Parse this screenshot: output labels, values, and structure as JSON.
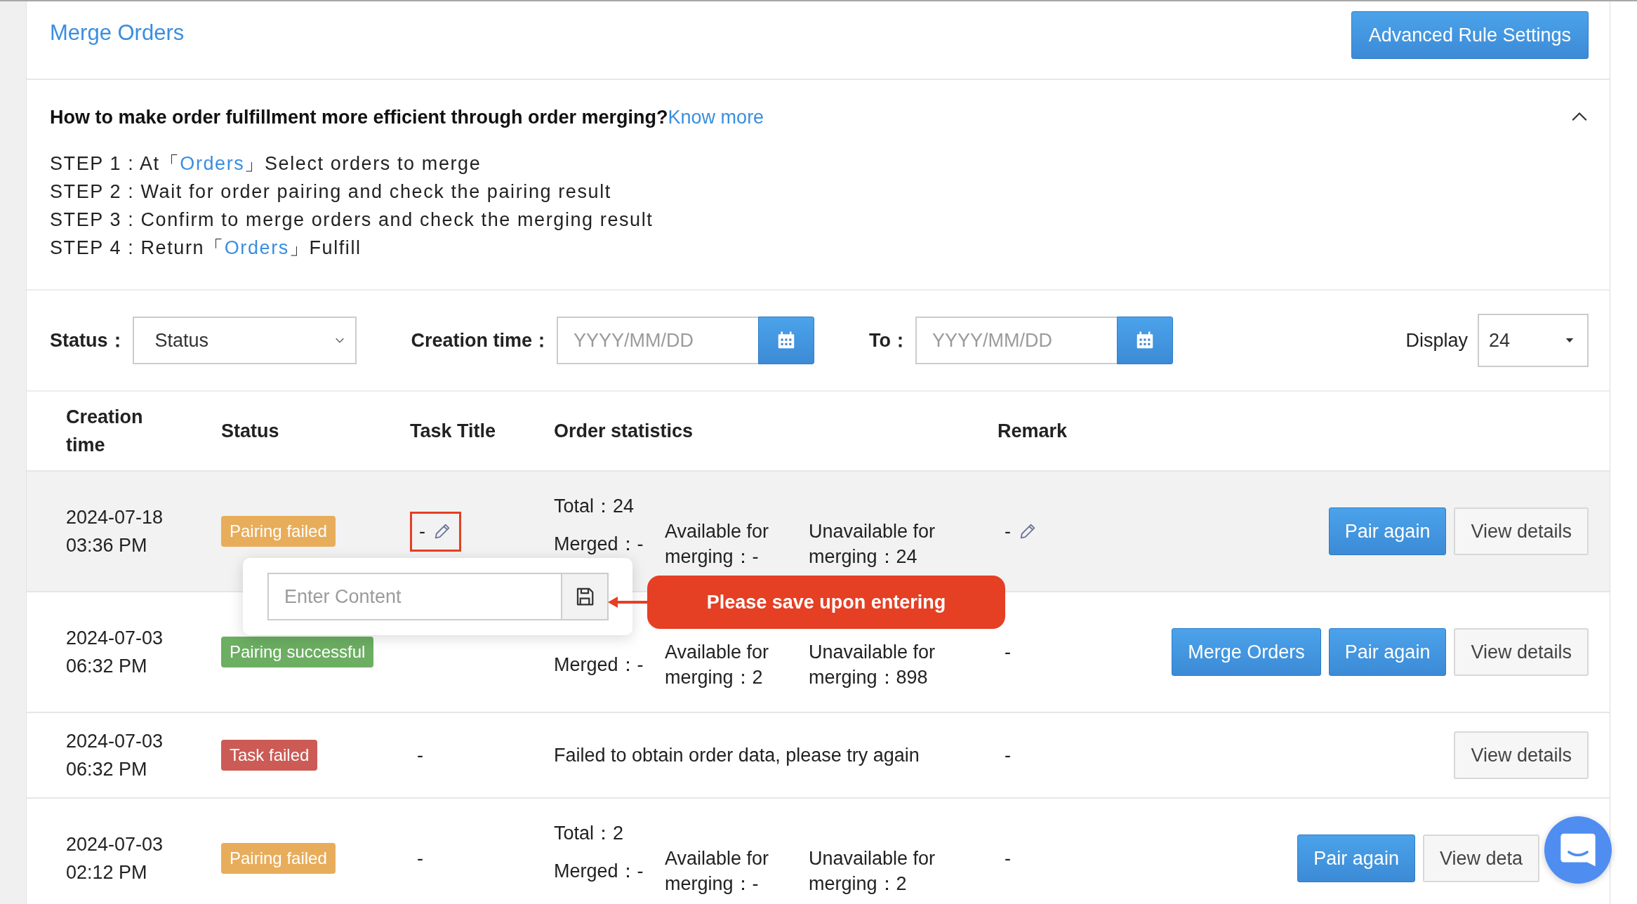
{
  "header": {
    "title": "Merge Orders",
    "button": "Advanced Rule Settings"
  },
  "guide": {
    "question": "How to make order fulfillment more efficient through order merging?",
    "link": "Know more",
    "expanded": true,
    "steps": [
      [
        {
          "text": "STEP 1 : At「"
        },
        {
          "text": "Orders",
          "link": true
        },
        {
          "text": "」Select orders to merge"
        }
      ],
      [
        {
          "text": "STEP 2 : Wait for order pairing and check the pairing result"
        }
      ],
      [
        {
          "text": "STEP 3 : Confirm to merge orders and check the merging result"
        }
      ],
      [
        {
          "text": "STEP 4 : Return「"
        },
        {
          "text": "Orders",
          "link": true
        },
        {
          "text": "」Fulfill"
        }
      ]
    ]
  },
  "filters": {
    "status_label": "Status：",
    "status_value": "Status",
    "creation_label": "Creation time：",
    "from_placeholder": "YYYY/MM/DD",
    "to_label": "To：",
    "to_placeholder": "YYYY/MM/DD",
    "display_label": "Display",
    "display_value": "24"
  },
  "table": {
    "columns": [
      "Creation time",
      "Status",
      "Task Title",
      "Order statistics",
      "Remark"
    ],
    "rows": [
      {
        "creation_time": "2024-07-18 03:36 PM",
        "status": {
          "label": "Pairing failed",
          "kind": "warning"
        },
        "task_title": "-",
        "task_editable": true,
        "highlighted": true,
        "hovered": true,
        "stats": {
          "kind": "counts",
          "total": "Total：24",
          "merged": "Merged：-",
          "available": "Available for merging：-",
          "unavailable": "Unavailable for merging：24"
        },
        "remark": "-",
        "remark_editable": true,
        "actions": [
          {
            "label": "Pair again",
            "kind": "primary"
          },
          {
            "label": "View details",
            "kind": "default"
          }
        ]
      },
      {
        "creation_time": "2024-07-03 06:32 PM",
        "status": {
          "label": "Pairing successful",
          "kind": "success"
        },
        "task_editable": false,
        "highlighted": false,
        "hovered": false,
        "stats": {
          "kind": "counts",
          "merged": "Merged：-",
          "available": "Available for merging：2",
          "unavailable": "Unavailable for merging：898"
        },
        "remark": "-",
        "remark_editable": false,
        "actions": [
          {
            "label": "Merge Orders",
            "kind": "primary"
          },
          {
            "label": "Pair again",
            "kind": "primary"
          },
          {
            "label": "View details",
            "kind": "default"
          }
        ]
      },
      {
        "creation_time": "2024-07-03 06:32 PM",
        "status": {
          "label": "Task failed",
          "kind": "danger"
        },
        "task_title": "-",
        "task_editable": false,
        "highlighted": false,
        "hovered": false,
        "stats": {
          "kind": "message",
          "text": "Failed to obtain order data, please try again"
        },
        "remark": "-",
        "remark_editable": false,
        "actions": [
          {
            "label": "View details",
            "kind": "default"
          }
        ]
      },
      {
        "creation_time": "2024-07-03 02:12 PM",
        "status": {
          "label": "Pairing failed",
          "kind": "warning"
        },
        "task_title": "-",
        "task_editable": false,
        "highlighted": false,
        "hovered": false,
        "stats": {
          "kind": "counts",
          "total": "Total：2",
          "merged": "Merged：-",
          "available": "Available for merging：-",
          "unavailable": "Unavailable for merging：2"
        },
        "remark": "-",
        "remark_editable": false,
        "actions": [
          {
            "label": "Pair again",
            "kind": "primary"
          },
          {
            "label": "View deta",
            "kind": "default"
          }
        ]
      }
    ]
  },
  "popover": {
    "placeholder": "Enter Content",
    "hint": "Please save upon entering"
  }
}
